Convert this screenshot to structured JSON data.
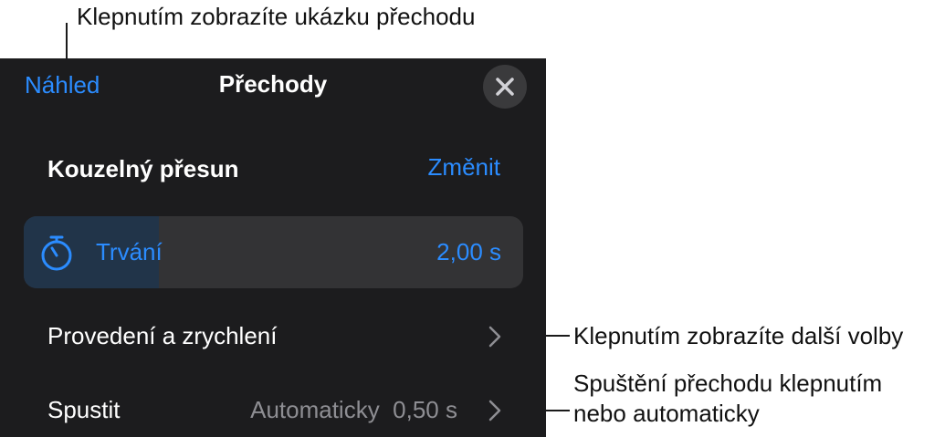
{
  "callouts": {
    "preview": "Klepnutím zobrazíte ukázku přechodu",
    "more_options": "Klepnutím zobrazíte další volby",
    "start_line1": "Spuštění přechodu klepnutím",
    "start_line2": "nebo automaticky"
  },
  "header": {
    "preview_label": "Náhled",
    "title": "Přechody",
    "close_icon": "close-icon"
  },
  "effect": {
    "name": "Kouzelný přesun",
    "change_label": "Změnit"
  },
  "duration": {
    "icon": "stopwatch-icon",
    "label": "Trvání",
    "value_text": "2,00 s",
    "fill_fraction": 0.27
  },
  "options": [
    {
      "label": "Provedení a zrychlení",
      "value": ""
    },
    {
      "label": "Spustit",
      "value": "Automaticky  0,50 s"
    }
  ],
  "colors": {
    "accent": "#2b8cff",
    "panel_bg": "#1c1c1e",
    "slider_bg": "#333335",
    "slider_fill": "#213449",
    "secondary_text": "#8e8e93"
  }
}
